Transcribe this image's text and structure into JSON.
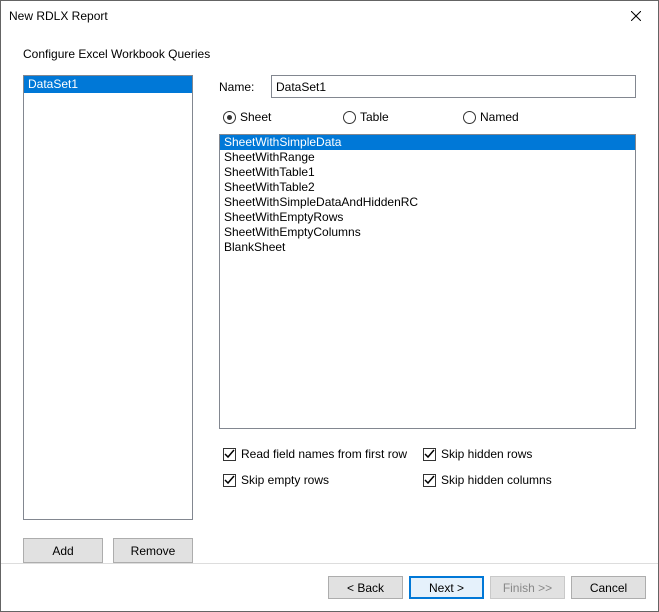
{
  "window": {
    "title": "New RDLX Report"
  },
  "heading": "Configure Excel Workbook Queries",
  "datasets": {
    "items": [
      "DataSet1"
    ],
    "selected_index": 0
  },
  "left_buttons": {
    "add": "Add",
    "remove": "Remove"
  },
  "name": {
    "label": "Name:",
    "value": "DataSet1"
  },
  "type_radios": {
    "options": [
      "Sheet",
      "Table",
      "Named"
    ],
    "selected_index": 0
  },
  "sheets": {
    "items": [
      "SheetWithSimpleData",
      "SheetWithRange",
      "SheetWithTable1",
      "SheetWithTable2",
      "SheetWithSimpleDataAndHiddenRC",
      "SheetWithEmptyRows",
      "SheetWithEmptyColumns",
      "BlankSheet"
    ],
    "selected_index": 0
  },
  "options": {
    "read_first_row": {
      "label": "Read field names from first row",
      "checked": true
    },
    "skip_hidden_rows": {
      "label": "Skip hidden rows",
      "checked": true
    },
    "skip_empty_rows": {
      "label": "Skip empty rows",
      "checked": true
    },
    "skip_hidden_columns": {
      "label": "Skip hidden columns",
      "checked": true
    }
  },
  "footer": {
    "back": "< Back",
    "next": "Next >",
    "finish": "Finish >>",
    "cancel": "Cancel"
  }
}
